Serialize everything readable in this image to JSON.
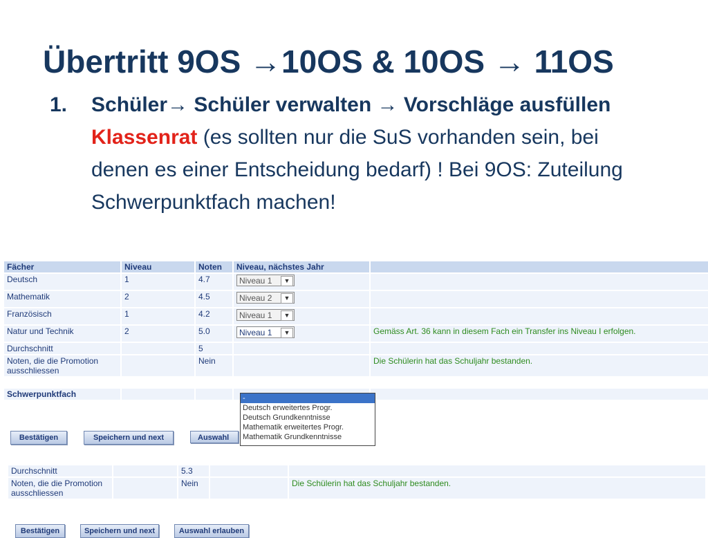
{
  "title": {
    "part1": "Übertritt 9OS ",
    "part2": "10OS & 10OS ",
    "part3": " 11OS"
  },
  "bullet": {
    "number": "1.",
    "seg1": "Schüler",
    "seg2": " Schüler verwalten ",
    "seg3": " Vorschläge ausfüllen ",
    "seg4": "Klassenrat",
    "seg5": " (es sollten nur die SuS vorhanden sein, bei denen es einer Entscheidung bedarf) ! Bei 9OS: Zuteilung Schwerpunktfach machen!"
  },
  "table1": {
    "headers": [
      "Fächer",
      "Niveau",
      "Noten",
      "Niveau, nächstes Jahr",
      ""
    ],
    "rows": [
      {
        "fach": "Deutsch",
        "niveau": "1",
        "note": "4.7",
        "next": "Niveau 1",
        "hint": ""
      },
      {
        "fach": "Mathematik",
        "niveau": "2",
        "note": "4.5",
        "next": "Niveau 2",
        "hint": ""
      },
      {
        "fach": "Französisch",
        "niveau": "1",
        "note": "4.2",
        "next": "Niveau 1",
        "hint": ""
      },
      {
        "fach": "Natur und Technik",
        "niveau": "2",
        "note": "5.0",
        "next": "Niveau 1",
        "hint": "Gemäss Art. 36 kann in diesem Fach ein Transfer ins Niveau I erfolgen."
      }
    ],
    "durchschnitt_label": "Durchschnitt",
    "durchschnitt_value": "5",
    "promotion_label": "Noten, die die Promotion ausschliessen",
    "promotion_value": "Nein",
    "promotion_hint": "Die Schülerin hat das Schuljahr bestanden.",
    "schwerpunkt_label": "Schwerpunktfach"
  },
  "listbox_options": [
    "-",
    "Deutsch erweitertes Progr.",
    "Deutsch Grundkenntnisse",
    "Mathematik erweitertes Progr.",
    "Mathematik Grundkenntnisse"
  ],
  "buttons1": {
    "confirm": "Bestätigen",
    "save_next": "Speichern und next",
    "allow": "Auswahl er"
  },
  "table2": {
    "durchschnitt_label": "Durchschnitt",
    "durchschnitt_value": "5.3",
    "promotion_label": "Noten, die die Promotion ausschliessen",
    "promotion_value": "Nein",
    "promotion_hint": "Die Schülerin hat das Schuljahr bestanden."
  },
  "buttons2": {
    "confirm": "Bestätigen",
    "save_next": "Speichern und next",
    "allow": "Auswahl erlauben"
  },
  "colors": {
    "title": "#17375e",
    "highlight": "#e2231a",
    "hint": "#2e8b1f"
  }
}
